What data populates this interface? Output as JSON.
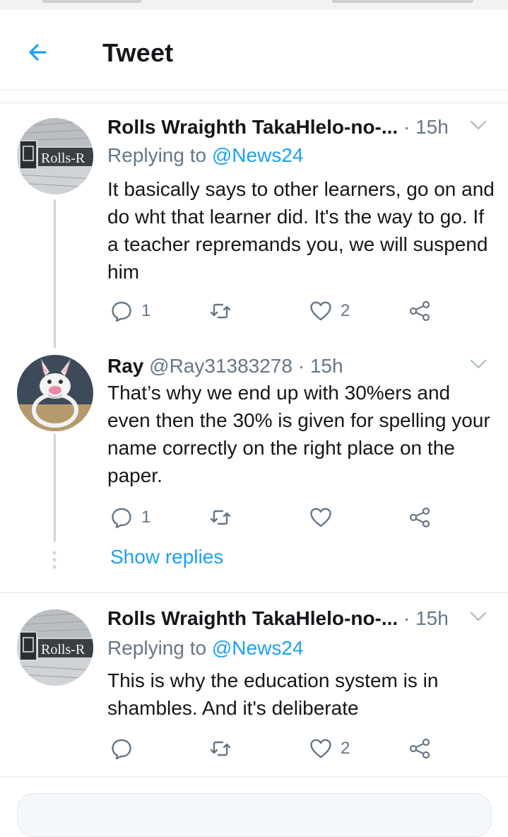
{
  "header": {
    "title": "Tweet"
  },
  "tweets": [
    {
      "name": "Rolls Wraighth TakaHlelo-no-...",
      "handle": "",
      "dot": "·",
      "time": "15h",
      "replying_prefix": "Replying to ",
      "replying_to": "@News24",
      "body": "It basically says to other learners, go on and do wht that learner did. It's the way to go. If a teacher repremands you, we will suspend him",
      "avatar_text": "Rolls-R",
      "reply_count": "1",
      "retweet_count": "",
      "like_count": "2"
    },
    {
      "name": "Ray",
      "handle": "@Ray31383278",
      "dot": "·",
      "time": "15h",
      "body": "That’s why we end up with 30%ers and even then the 30% is given for spelling your name correctly on the right place on the paper.",
      "reply_count": "1",
      "retweet_count": "",
      "like_count": ""
    },
    {
      "name": "Rolls Wraighth TakaHlelo-no-...",
      "handle": "",
      "dot": "·",
      "time": "15h",
      "replying_prefix": "Replying to ",
      "replying_to": "@News24",
      "body": "This is why the education system is in shambles. And it's deliberate",
      "avatar_text": "Rolls-R",
      "reply_count": "",
      "retweet_count": "",
      "like_count": "2"
    }
  ],
  "show_replies_label": "Show replies",
  "colors": {
    "accent": "#1da1f2",
    "muted": "#657786",
    "text": "#14171a",
    "divider": "#e1e8ed"
  }
}
